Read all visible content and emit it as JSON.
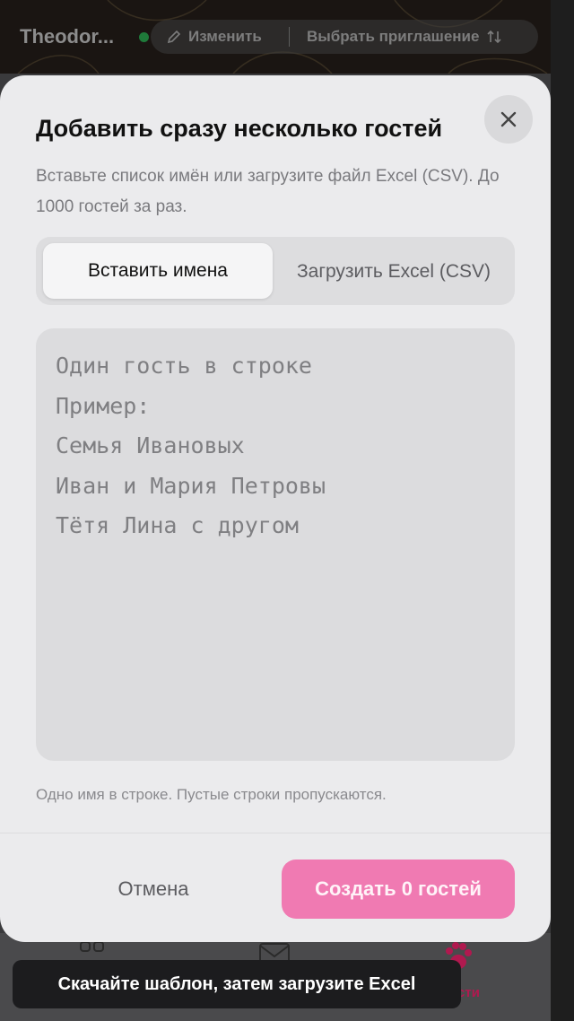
{
  "app": {
    "title": "Theodor...",
    "edit_label": "Изменить",
    "choose_invitation_label": "Выбрать приглашение"
  },
  "modal": {
    "title": "Добавить сразу несколько гостей",
    "description": "Вставьте список имён или загрузите файл Excel (CSV). До 1000 гостей за раз.",
    "tabs": [
      {
        "label": "Вставить имена",
        "active": true
      },
      {
        "label": "Загрузить Excel (CSV)",
        "active": false
      }
    ],
    "textarea": {
      "value": "",
      "placeholder_lines": [
        "Один гость в строке",
        "Пример:",
        "Семья Ивановых",
        "Иван и Мария Петровы",
        "Тётя Лина с другом"
      ]
    },
    "hint": "Одно имя в строке. Пустые строки пропускаются.",
    "cancel_label": "Отмена",
    "create_label": "Создать 0 гостей"
  },
  "bottom_nav": {
    "active_label_partial": "сти"
  },
  "toast": {
    "message": "Скачайте шаблон, затем загрузите Excel"
  },
  "colors": {
    "accent": "#f07ab2",
    "modal_bg": "#ebebed",
    "online_dot": "#1f7a3a",
    "nav_active": "#b0194f"
  },
  "icons": {
    "close": "close-icon",
    "edit": "pencil-icon",
    "sort": "sort-arrows-icon",
    "nav_grid": "grid-icon",
    "nav_mail": "mail-icon",
    "nav_paw": "paw-icon"
  }
}
